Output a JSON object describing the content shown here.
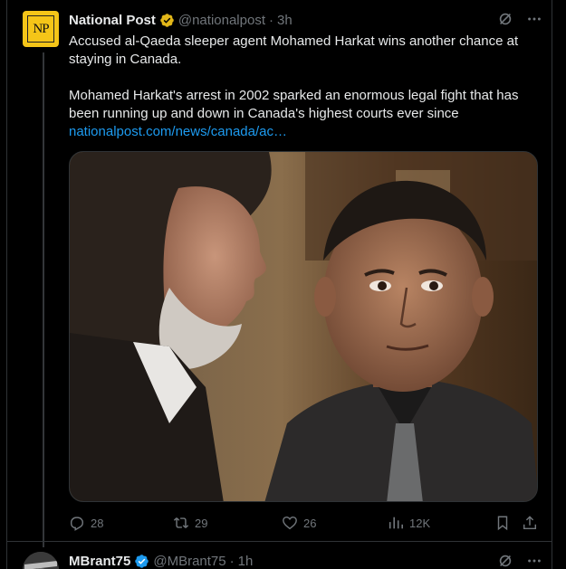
{
  "tweet": {
    "author_name": "National Post",
    "handle": "@nationalpost",
    "separator": "·",
    "time": "3h",
    "avatar_text": "NP",
    "verified": "gold-verified-icon",
    "text_line1": "Accused al-Qaeda sleeper agent Mohamed Harkat wins another chance at staying in Canada.",
    "text_line2": "Mohamed Harkat's arrest in 2002 sparked an enormous legal fight that has been running up and down in Canada's highest courts ever since",
    "link": "nationalpost.com/news/canada/ac…",
    "actions": {
      "replies": "28",
      "retweets": "29",
      "likes": "26",
      "views": "12K"
    }
  },
  "next_tweet": {
    "author_name": "MBrant75",
    "handle": "@MBrant75",
    "separator": "·",
    "time": "1h",
    "verified": "blue-verified-icon"
  },
  "colors": {
    "background": "#000000",
    "text": "#e7e9ea",
    "muted": "#71767b",
    "link": "#1d9bf0",
    "gold_badge": "#e2b719",
    "blue_badge": "#1d9bf0",
    "border": "#2f3336"
  }
}
